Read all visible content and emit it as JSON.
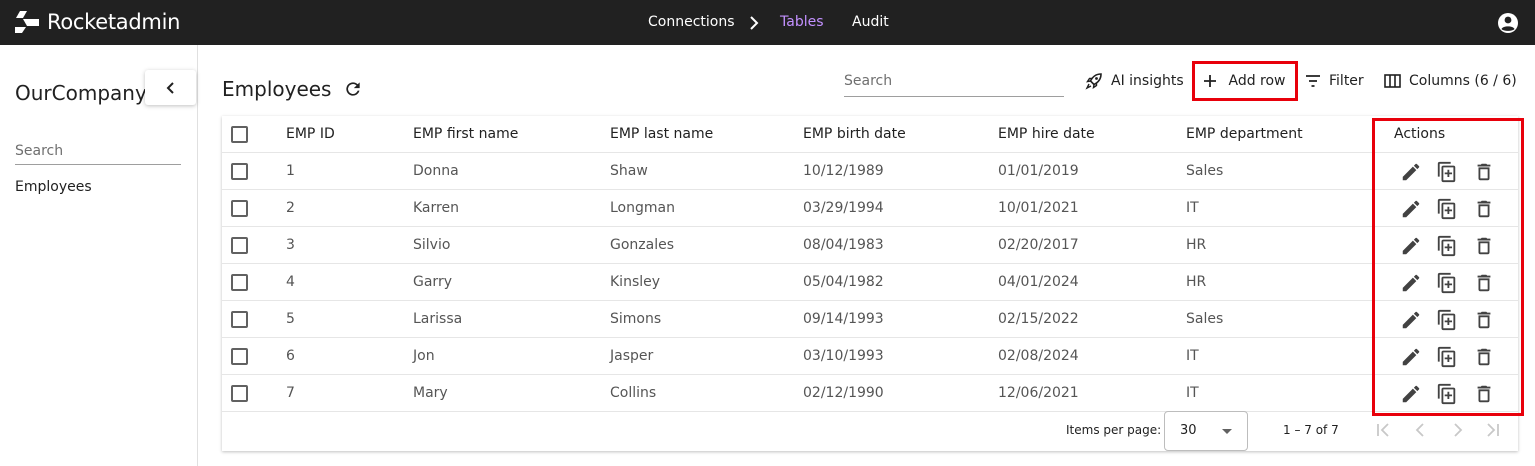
{
  "app": {
    "name": "Rocketadmin"
  },
  "topnav": {
    "connections": "Connections",
    "tables": "Tables",
    "audit": "Audit",
    "active_color": "#c391ff"
  },
  "sidebar": {
    "title": "OurCompany",
    "search_placeholder": "Search",
    "items": [
      {
        "label": "Employees"
      }
    ]
  },
  "main": {
    "title": "Employees",
    "search_placeholder": "Search",
    "toolbar": {
      "ai_insights": "AI insights",
      "add_row": "Add row",
      "filter": "Filter",
      "columns": "Columns (6 / 6)"
    }
  },
  "table": {
    "columns": [
      "EMP ID",
      "EMP first name",
      "EMP last name",
      "EMP birth date",
      "EMP hire date",
      "EMP department",
      "Actions"
    ],
    "rows": [
      [
        "1",
        "Donna",
        "Shaw",
        "10/12/1989",
        "01/01/2019",
        "Sales"
      ],
      [
        "2",
        "Karren",
        "Longman",
        "03/29/1994",
        "10/01/2021",
        "IT"
      ],
      [
        "3",
        "Silvio",
        "Gonzales",
        "08/04/1983",
        "02/20/2017",
        "HR"
      ],
      [
        "4",
        "Garry",
        "Kinsley",
        "05/04/1982",
        "04/01/2024",
        "HR"
      ],
      [
        "5",
        "Larissa",
        "Simons",
        "09/14/1993",
        "02/15/2022",
        "Sales"
      ],
      [
        "6",
        "Jon",
        "Jasper",
        "03/10/1993",
        "02/08/2024",
        "IT"
      ],
      [
        "7",
        "Mary",
        "Collins",
        "02/12/1990",
        "12/06/2021",
        "IT"
      ]
    ]
  },
  "paginator": {
    "items_per_page_label": "Items per page:",
    "page_size": "30",
    "range": "1 – 7 of 7"
  },
  "highlight_color": "#e8000b"
}
